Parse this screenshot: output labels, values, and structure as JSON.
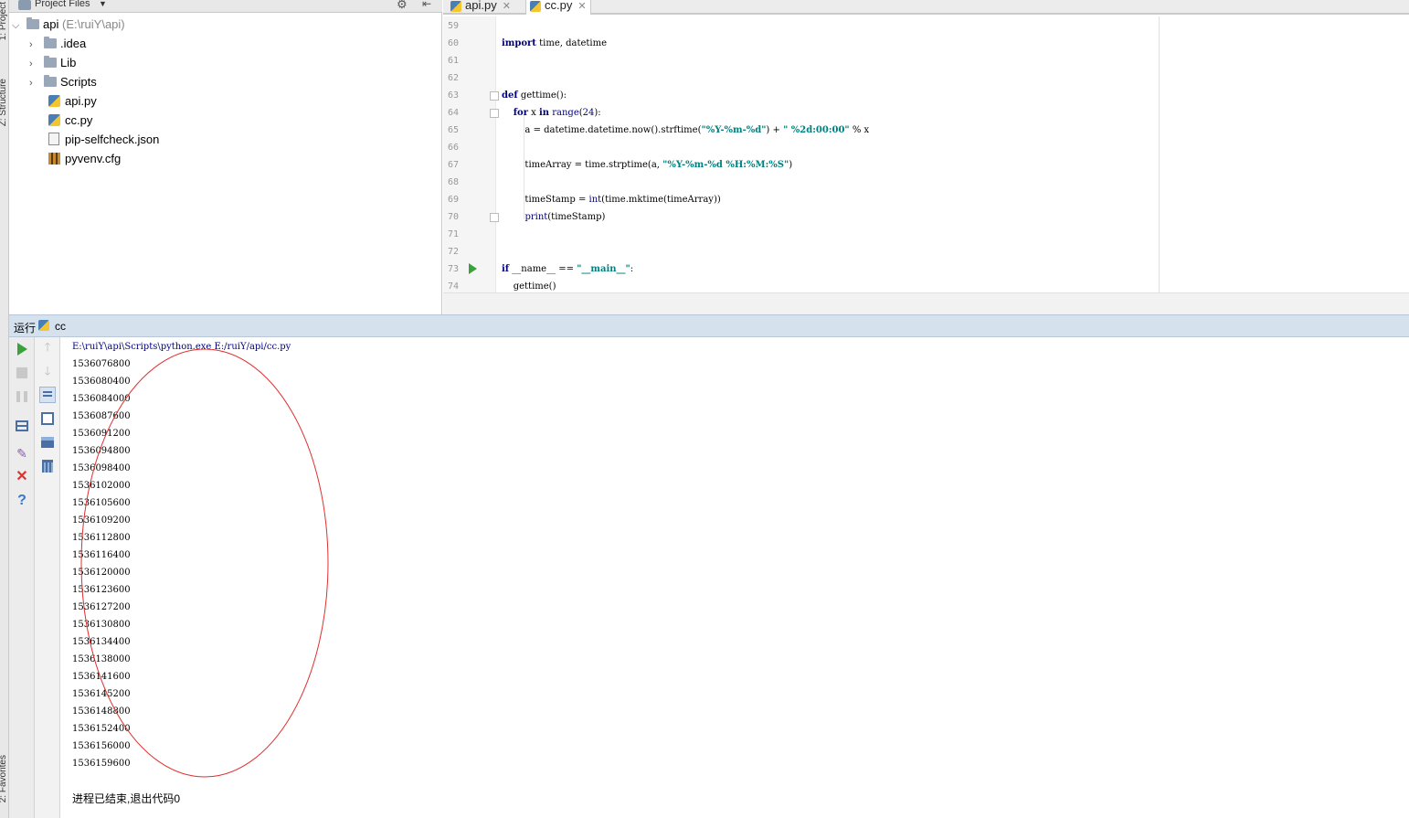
{
  "left_strip": {
    "tab_project": "1: Project",
    "tab_structure": "Z: Structure",
    "tab_favorites": "2: Favorites"
  },
  "project_panel": {
    "header_title": "Project Files",
    "tree": [
      {
        "name": "api",
        "path": "(E:\\ruiY\\api)",
        "type": "folder",
        "expanded": true
      },
      {
        "name": ".idea",
        "type": "folder"
      },
      {
        "name": "Lib",
        "type": "folder"
      },
      {
        "name": "Scripts",
        "type": "folder"
      },
      {
        "name": "api.py",
        "type": "py"
      },
      {
        "name": "cc.py",
        "type": "py"
      },
      {
        "name": "pip-selfcheck.json",
        "type": "json"
      },
      {
        "name": "pyvenv.cfg",
        "type": "cfg"
      }
    ]
  },
  "editor": {
    "tabs": [
      {
        "label": "api.py",
        "active": false
      },
      {
        "label": "cc.py",
        "active": true
      }
    ],
    "line_numbers": [
      "59",
      "60",
      "61",
      "62",
      "63",
      "64",
      "65",
      "66",
      "67",
      "68",
      "69",
      "70",
      "71",
      "72",
      "73",
      "74"
    ]
  },
  "run_panel": {
    "label": "运行",
    "config_name": "cc",
    "command": "E:\\ruiY\\api\\Scripts\\python.exe E:/ruiY/api/cc.py",
    "output": [
      "1536076800",
      "1536080400",
      "1536084000",
      "1536087600",
      "1536091200",
      "1536094800",
      "1536098400",
      "1536102000",
      "1536105600",
      "1536109200",
      "1536112800",
      "1536116400",
      "1536120000",
      "1536123600",
      "1536127200",
      "1536130800",
      "1536134400",
      "1536138000",
      "1536141600",
      "1536145200",
      "1536148800",
      "1536152400",
      "1536156000",
      "1536159600"
    ],
    "exit_message": "进程已结束,退出代码0"
  },
  "colors": {
    "keyword": "#000080",
    "string": "#008080",
    "annotation": "#e03030",
    "run_green": "#3aa23a"
  }
}
